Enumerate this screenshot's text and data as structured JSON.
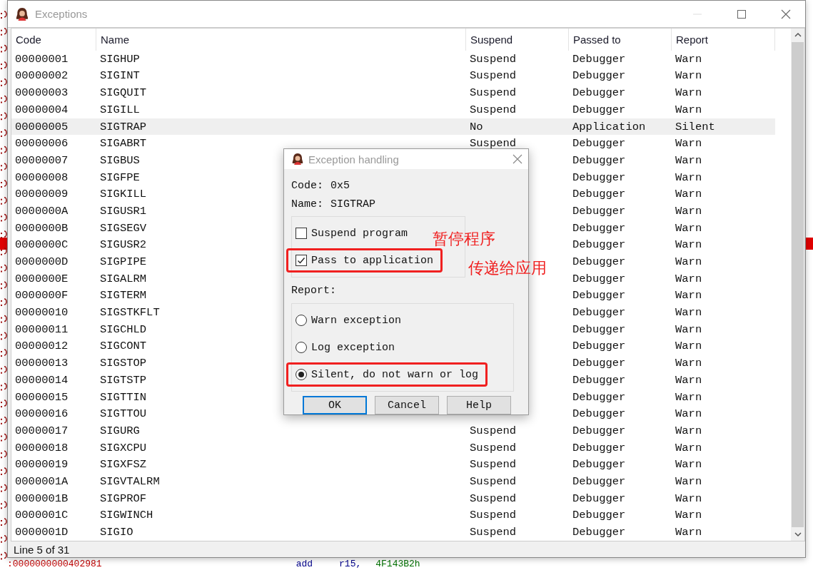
{
  "background": {
    "code_line": [
      {
        "kind": "address",
        "text": ":0000000000402981"
      },
      {
        "kind": "mnemonic",
        "text": "add"
      },
      {
        "kind": "operand",
        "text": "r15,"
      },
      {
        "kind": "number",
        "text": "4F143B2h"
      }
    ]
  },
  "window": {
    "title": "Exceptions"
  },
  "table": {
    "columns": [
      "Code",
      "Name",
      "Suspend",
      "Passed to",
      "Report"
    ],
    "rows": [
      {
        "code": "00000001",
        "name": "SIGHUP",
        "suspend": "Suspend",
        "passed": "Debugger",
        "report": "Warn",
        "selected": false
      },
      {
        "code": "00000002",
        "name": "SIGINT",
        "suspend": "Suspend",
        "passed": "Debugger",
        "report": "Warn",
        "selected": false
      },
      {
        "code": "00000003",
        "name": "SIGQUIT",
        "suspend": "Suspend",
        "passed": "Debugger",
        "report": "Warn",
        "selected": false
      },
      {
        "code": "00000004",
        "name": "SIGILL",
        "suspend": "Suspend",
        "passed": "Debugger",
        "report": "Warn",
        "selected": false
      },
      {
        "code": "00000005",
        "name": "SIGTRAP",
        "suspend": "No",
        "passed": "Application",
        "report": "Silent",
        "selected": true
      },
      {
        "code": "00000006",
        "name": "SIGABRT",
        "suspend": "Suspend",
        "passed": "Debugger",
        "report": "Warn",
        "selected": false
      },
      {
        "code": "00000007",
        "name": "SIGBUS",
        "passed": "Debugger",
        "report": "Warn",
        "selected": false
      },
      {
        "code": "00000008",
        "name": "SIGFPE",
        "passed": "Debugger",
        "report": "Warn",
        "selected": false
      },
      {
        "code": "00000009",
        "name": "SIGKILL",
        "passed": "Debugger",
        "report": "Warn",
        "selected": false
      },
      {
        "code": "0000000A",
        "name": "SIGUSR1",
        "passed": "Debugger",
        "report": "Warn",
        "selected": false
      },
      {
        "code": "0000000B",
        "name": "SIGSEGV",
        "passed": "Debugger",
        "report": "Warn",
        "selected": false
      },
      {
        "code": "0000000C",
        "name": "SIGUSR2",
        "passed": "Debugger",
        "report": "Warn",
        "selected": false
      },
      {
        "code": "0000000D",
        "name": "SIGPIPE",
        "passed": "Debugger",
        "report": "Warn",
        "selected": false
      },
      {
        "code": "0000000E",
        "name": "SIGALRM",
        "passed": "Debugger",
        "report": "Warn",
        "selected": false
      },
      {
        "code": "0000000F",
        "name": "SIGTERM",
        "passed": "Debugger",
        "report": "Warn",
        "selected": false
      },
      {
        "code": "00000010",
        "name": "SIGSTKFLT",
        "passed": "Debugger",
        "report": "Warn",
        "selected": false
      },
      {
        "code": "00000011",
        "name": "SIGCHLD",
        "passed": "Debugger",
        "report": "Warn",
        "selected": false
      },
      {
        "code": "00000012",
        "name": "SIGCONT",
        "passed": "Debugger",
        "report": "Warn",
        "selected": false
      },
      {
        "code": "00000013",
        "name": "SIGSTOP",
        "passed": "Debugger",
        "report": "Warn",
        "selected": false
      },
      {
        "code": "00000014",
        "name": "SIGTSTP",
        "passed": "Debugger",
        "report": "Warn",
        "selected": false
      },
      {
        "code": "00000015",
        "name": "SIGTTIN",
        "passed": "Debugger",
        "report": "Warn",
        "selected": false
      },
      {
        "code": "00000016",
        "name": "SIGTTOU",
        "passed": "Debugger",
        "report": "Warn",
        "selected": false
      },
      {
        "code": "00000017",
        "name": "SIGURG",
        "suspend": "Suspend",
        "passed": "Debugger",
        "report": "Warn",
        "selected": false
      },
      {
        "code": "00000018",
        "name": "SIGXCPU",
        "suspend": "Suspend",
        "passed": "Debugger",
        "report": "Warn",
        "selected": false
      },
      {
        "code": "00000019",
        "name": "SIGXFSZ",
        "suspend": "Suspend",
        "passed": "Debugger",
        "report": "Warn",
        "selected": false
      },
      {
        "code": "0000001A",
        "name": "SIGVTALRM",
        "suspend": "Suspend",
        "passed": "Debugger",
        "report": "Warn",
        "selected": false
      },
      {
        "code": "0000001B",
        "name": "SIGPROF",
        "suspend": "Suspend",
        "passed": "Debugger",
        "report": "Warn",
        "selected": false
      },
      {
        "code": "0000001C",
        "name": "SIGWINCH",
        "suspend": "Suspend",
        "passed": "Debugger",
        "report": "Warn",
        "selected": false
      },
      {
        "code": "0000001D",
        "name": "SIGIO",
        "suspend": "Suspend",
        "passed": "Debugger",
        "report": "Warn",
        "selected": false
      }
    ]
  },
  "status_bar": {
    "text": "Line 5 of 31"
  },
  "dialog": {
    "title": "Exception handling",
    "code_label": "Code:",
    "code_value": "0x5",
    "name_label": "Name:",
    "name_value": "SIGTRAP",
    "options": [
      {
        "label": "Suspend program",
        "checked": false,
        "highlighted": false,
        "note": "暂停程序"
      },
      {
        "label": "Pass to application",
        "checked": true,
        "highlighted": true,
        "note": "传递给应用"
      }
    ],
    "report_label": "Report:",
    "report_choices": [
      {
        "label": "Warn exception",
        "selected": false,
        "highlighted": false
      },
      {
        "label": "Log exception",
        "selected": false,
        "highlighted": false
      },
      {
        "label": "Silent, do not warn or log",
        "selected": true,
        "highlighted": true
      }
    ],
    "buttons": [
      {
        "label": "OK",
        "default": true
      },
      {
        "label": "Cancel",
        "default": false
      },
      {
        "label": "Help",
        "default": false
      }
    ]
  }
}
